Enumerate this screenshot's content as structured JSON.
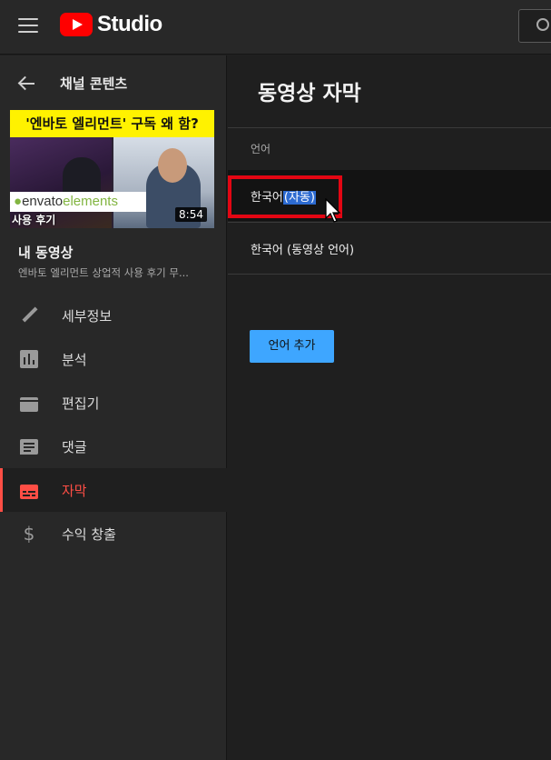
{
  "app": {
    "logo_text": "Studio",
    "icons": {
      "menu": "hamburger-menu-icon",
      "search": "search-icon",
      "logo": "youtube-play-logo"
    }
  },
  "sidebar": {
    "back_label": "채널 콘텐츠",
    "thumbnail": {
      "title_text": "'엔바토 엘리먼트' 구독 왜 함?",
      "brand_text_g": "●",
      "brand_text": "envato",
      "brand_text_2": "elements",
      "review_text": "사용 후기",
      "duration": "8:54"
    },
    "video_section_title": "내 동영상",
    "video_description": "엔바토 엘리먼트 상업적 사용 후기 무...",
    "nav": [
      {
        "label": "세부정보",
        "icon": "pencil-icon",
        "active": false
      },
      {
        "label": "분석",
        "icon": "analytics-icon",
        "active": false
      },
      {
        "label": "편집기",
        "icon": "clapperboard-icon",
        "active": false
      },
      {
        "label": "댓글",
        "icon": "comment-icon",
        "active": false
      },
      {
        "label": "자막",
        "icon": "subtitles-icon",
        "active": true
      },
      {
        "label": "수익 창출",
        "icon": "dollar-icon",
        "active": false
      }
    ]
  },
  "main": {
    "title": "동영상 자막",
    "column_header": "언어",
    "languages": [
      {
        "name_prefix": "한국어",
        "name_highlight": "(자동)",
        "selected": true
      },
      {
        "name": "한국어 (동영상 언어)"
      }
    ],
    "add_button_label": "언어 추가"
  },
  "colors": {
    "accent_red": "#ff4e45",
    "youtube_red": "#ff0000",
    "button_blue": "#3ea6ff",
    "highlight_blue": "#2d6bd1",
    "annotation_red": "#e30613"
  }
}
